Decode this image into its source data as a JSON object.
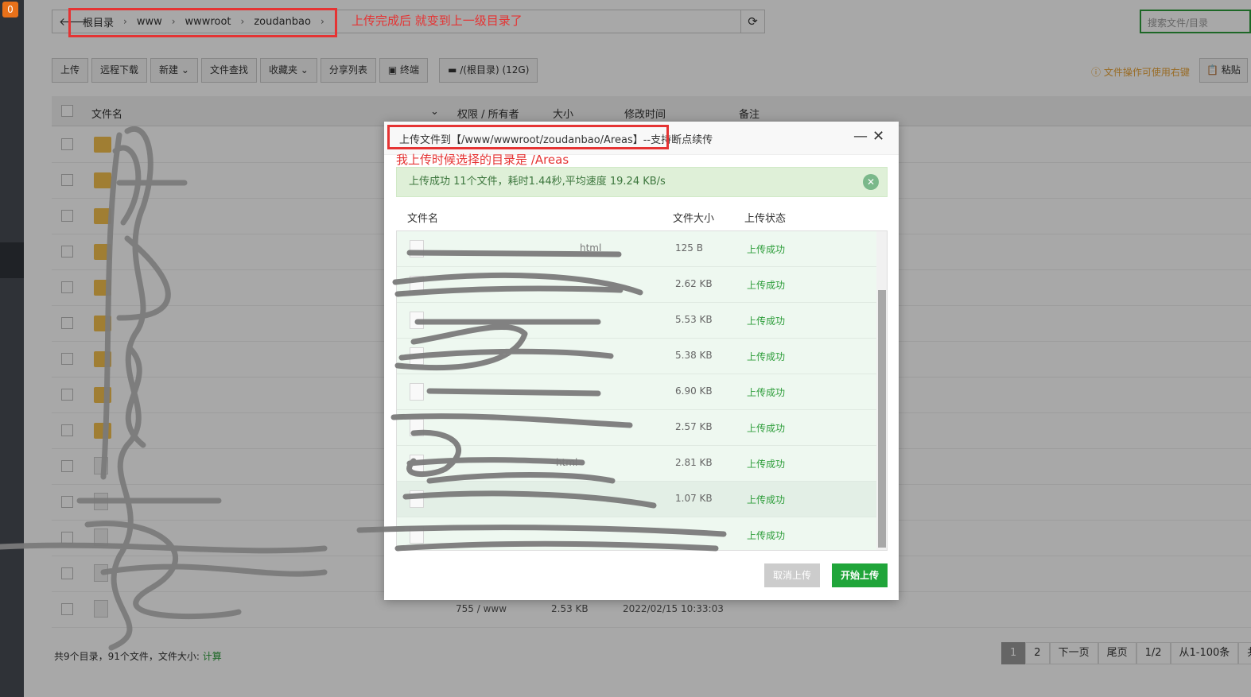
{
  "sidebar": {
    "badge": "0"
  },
  "path": {
    "crumbs": [
      "根目录",
      "www",
      "wwwroot",
      "zoudanbao"
    ],
    "back_icon": "back-arrow-icon",
    "refresh_icon": "refresh-icon"
  },
  "search": {
    "placeholder": "搜索文件/目录"
  },
  "toolbar": {
    "buttons": [
      "上传",
      "远程下载",
      "新建",
      "文件查找",
      "收藏夹",
      "分享列表",
      "终端"
    ],
    "disk": "/(根目录) (12G)",
    "tip": "文件操作可使用右键",
    "paste": "粘贴"
  },
  "table": {
    "headers": [
      "文件名",
      "权限 / 所有者",
      "大小",
      "修改时间",
      "备注"
    ],
    "last_row": {
      "perm": "755 / www",
      "size": "2.53 KB",
      "time": "2022/02/15 10:33:03"
    }
  },
  "footer": {
    "summary": "共9个目录，91个文件，文件大小: ",
    "calc": "计算"
  },
  "pager": [
    "1",
    "2",
    "下一页",
    "尾页",
    "1/2",
    "从1-100条",
    "共"
  ],
  "annotations": {
    "top": "上传完成后 就变到上一级目录了",
    "modal": "我上传时候选择的目录是 /Areas"
  },
  "modal": {
    "title": "上传文件到【/www/wwwroot/zoudanbao/Areas】--支持断点续传",
    "success": "上传成功 11个文件，耗时1.44秒,平均速度 19.24 KB/s",
    "headers": [
      "文件名",
      "文件大小",
      "上传状态"
    ],
    "files": [
      {
        "name": "html",
        "size": "125 B",
        "status": "上传成功"
      },
      {
        "name": "",
        "size": "2.62 KB",
        "status": "上传成功"
      },
      {
        "name": "",
        "size": "5.53 KB",
        "status": "上传成功"
      },
      {
        "name": "",
        "size": "5.38 KB",
        "status": "上传成功"
      },
      {
        "name": "",
        "size": "6.90 KB",
        "status": "上传成功"
      },
      {
        "name": "",
        "size": "2.57 KB",
        "status": "上传成功"
      },
      {
        "name": "html",
        "size": "2.81 KB",
        "status": "上传成功"
      },
      {
        "name": "",
        "size": "1.07 KB",
        "status": "上传成功"
      },
      {
        "name": "",
        "size": "",
        "status": "上传成功"
      }
    ],
    "cancel": "取消上传",
    "start": "开始上传"
  }
}
